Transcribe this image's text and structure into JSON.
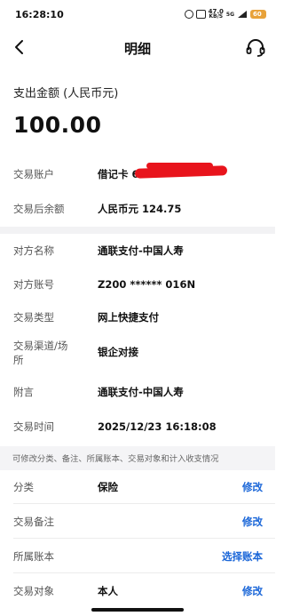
{
  "status_bar": {
    "time": "16:28:10",
    "speed_value": "47.0",
    "speed_unit": "KB/S",
    "network": "5G",
    "battery": "60"
  },
  "nav": {
    "title": "明细",
    "back_icon": "chevron-left-icon",
    "service_icon": "headset-icon"
  },
  "amount": {
    "label": "支出金额 (人民币元)",
    "value": "100.00"
  },
  "account_section": [
    {
      "label": "交易账户",
      "value": "借记卡 6"
    },
    {
      "label": "交易后余额",
      "value": "人民币元 124.75"
    }
  ],
  "detail_section": [
    {
      "label": "对方名称",
      "value": "通联支付-中国人寿"
    },
    {
      "label": "对方账号",
      "value": "Z200 ****** 016N"
    },
    {
      "label": "交易类型",
      "value": "网上快捷支付"
    },
    {
      "label": "交易渠道/场所",
      "value": "银企对接"
    },
    {
      "label": "附言",
      "value": "通联支付-中国人寿"
    },
    {
      "label": "交易时间",
      "value": "2025/12/23 16:18:08"
    }
  ],
  "hint": "可修改分类、备注、所属账本、交易对象和计入收支情况",
  "edit_section": [
    {
      "label": "分类",
      "value": "保险",
      "action": "修改"
    },
    {
      "label": "交易备注",
      "value": "",
      "action": "修改"
    },
    {
      "label": "所属账本",
      "value": "",
      "action": "选择账本"
    },
    {
      "label": "交易对象",
      "value": "本人",
      "action": "修改"
    }
  ],
  "colors": {
    "accent": "#1a66d8",
    "redaction": "#e8141c",
    "band": "#f2f2f4"
  }
}
